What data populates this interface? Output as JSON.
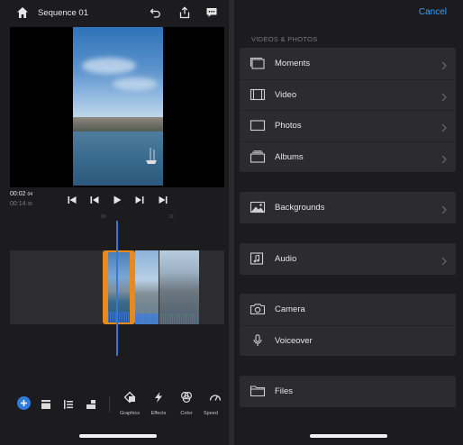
{
  "editor": {
    "title": "Sequence 01",
    "time_current": "00:02",
    "time_current_frames": "04",
    "time_total": "00:14",
    "time_total_frames": "05",
    "ruler_ticks": [
      "00",
      "10"
    ],
    "toolbar": [
      {
        "icon": "add-icon",
        "label": ""
      },
      {
        "icon": "layout-icon",
        "label": ""
      },
      {
        "icon": "align-icon",
        "label": ""
      },
      {
        "icon": "crop-icon",
        "label": ""
      },
      {
        "icon": "graphics-icon",
        "label": "Graphics"
      },
      {
        "icon": "effects-icon",
        "label": "Effects"
      },
      {
        "icon": "color-icon",
        "label": "Color"
      },
      {
        "icon": "speed-icon",
        "label": "Speed"
      }
    ],
    "accent": "#2f7bdc",
    "selection_color": "#e8891d"
  },
  "picker": {
    "cancel_label": "Cancel",
    "section_label": "VIDEOS & PHOTOS",
    "media_items": [
      {
        "icon": "moments-icon",
        "label": "Moments"
      },
      {
        "icon": "video-icon",
        "label": "Video"
      },
      {
        "icon": "photos-icon",
        "label": "Photos"
      },
      {
        "icon": "albums-icon",
        "label": "Albums"
      }
    ],
    "backgrounds": {
      "icon": "image-icon",
      "label": "Backgrounds"
    },
    "audio": {
      "icon": "music-icon",
      "label": "Audio"
    },
    "capture_items": [
      {
        "icon": "camera-icon",
        "label": "Camera"
      },
      {
        "icon": "microphone-icon",
        "label": "Voiceover"
      }
    ],
    "files": {
      "icon": "folder-icon",
      "label": "Files"
    },
    "accent": "#3f9cf2"
  }
}
